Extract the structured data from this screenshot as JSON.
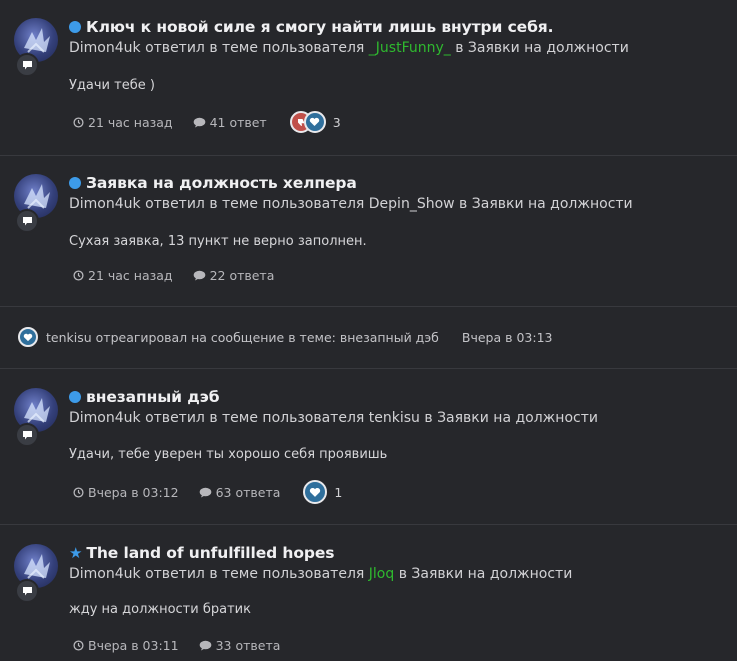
{
  "posts": [
    {
      "title": "Ключ к новой силе я смогу найти лишь внутри себя.",
      "marker": "dot",
      "meta_author": "Dimon4uk",
      "meta_mid": " ответил в теме пользователя ",
      "meta_topic_user": "_JustFunny_",
      "meta_topic_user_color": "#2fb92f",
      "meta_tail": " в Заявки на должности",
      "snippet": "Удачи тебе )",
      "time": "21 час назад",
      "replies": "41 ответ",
      "reactions": [
        "dislike-icon",
        "heart-icon"
      ],
      "reaction_count": "3"
    },
    {
      "title": "Заявка на должность хелпера",
      "marker": "dot",
      "meta_author": "Dimon4uk",
      "meta_mid": " ответил в теме пользователя ",
      "meta_topic_user": "Depin_Show",
      "meta_topic_user_color": "#d2d2d5",
      "meta_tail": " в Заявки на должности",
      "snippet": "Сухая заявка, 13 пункт не верно заполнен.",
      "time": "21 час назад",
      "replies": "22 ответа"
    },
    {
      "title": "внезапный дэб",
      "marker": "dot",
      "meta_author": "Dimon4uk",
      "meta_mid": " ответил в теме пользователя ",
      "meta_topic_user": "tenkisu",
      "meta_topic_user_color": "#d2d2d5",
      "meta_tail": " в Заявки на должности",
      "snippet": "Удачи, тебе уверен ты хорошо себя проявишь",
      "time": "Вчера в 03:12",
      "replies": "63 ответа",
      "reactions": [
        "heart-icon"
      ],
      "reaction_count": "1"
    },
    {
      "title": "The land of unfulfilled hopes",
      "marker": "star",
      "meta_author": "Dimon4uk",
      "meta_mid": " ответил в теме пользователя ",
      "meta_topic_user": "Jloq",
      "meta_topic_user_color": "#2fb92f",
      "meta_tail": " в Заявки на должности",
      "snippet": "жду на должности братик",
      "time": "Вчера в 03:11",
      "replies": "33 ответа"
    }
  ],
  "activity": {
    "text": "tenkisu отреагировал на сообщение в теме: внезапный дэб",
    "time": "Вчера в 03:13",
    "icon": "heart-icon"
  },
  "colors": {
    "background": "#26272b",
    "accent_blue": "#3d9be9",
    "username_green": "#2fb92f",
    "heart_blue": "#2f6f9c",
    "dislike_red": "#c0504a"
  }
}
